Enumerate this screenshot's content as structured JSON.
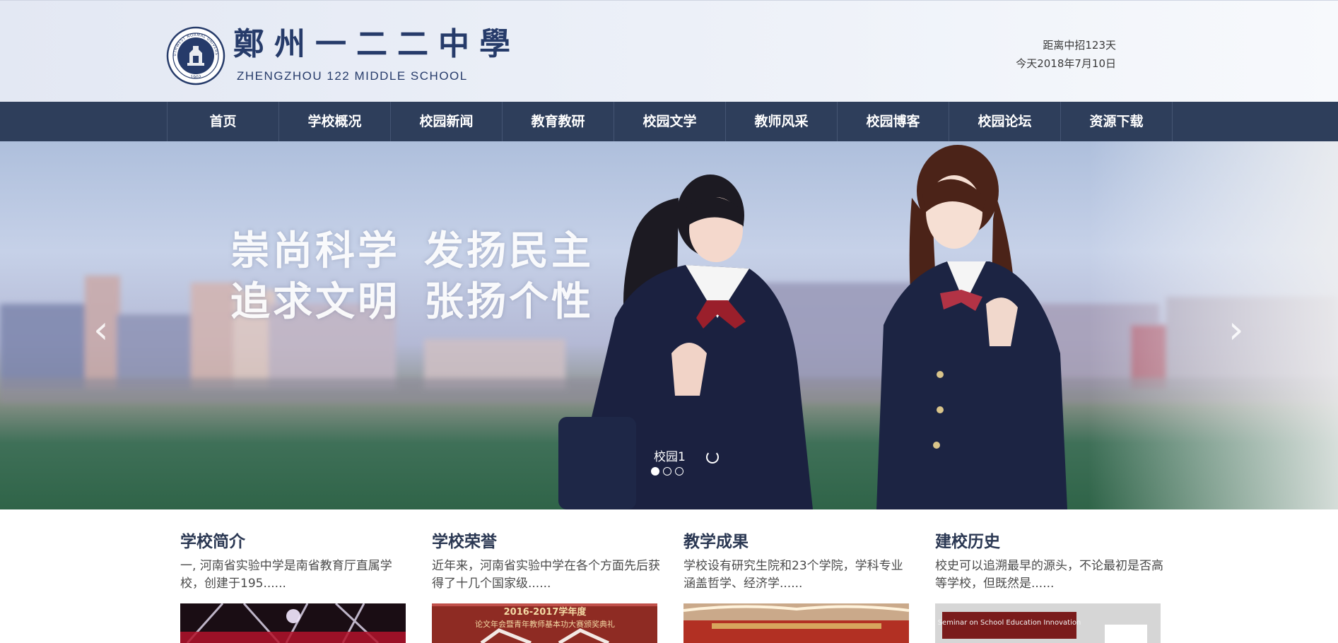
{
  "header": {
    "logo_cn": "鄭州一二二中學",
    "logo_en": "ZHENGZHOU 122 MIDDLE SCHOOL",
    "seal_text": "SOUTHWEST NORMAL UNIVERSITY",
    "seal_year": "1902",
    "countdown": "距离中招123天",
    "today": "今天2018年7月10日"
  },
  "nav": {
    "items": [
      "首页",
      "学校概况",
      "校园新闻",
      "教育教研",
      "校园文学",
      "教师风采",
      "校园博客",
      "校园论坛",
      "资源下载"
    ]
  },
  "banner": {
    "slogan_line1_a": "崇尚科学",
    "slogan_line1_b": "发扬民主",
    "slogan_line2_a": "追求文明",
    "slogan_line2_b": "张扬个性",
    "caption": "校园1",
    "prev_arrow": "‹",
    "next_arrow": "›",
    "slide_count": 3,
    "active_slide": 1
  },
  "cards": [
    {
      "title": "学校简介",
      "text": "一, 河南省实验中学是南省教育厅直属学校，创建于195......"
    },
    {
      "title": "学校荣誉",
      "text": "近年来，河南省实验中学在各个方面先后获得了十几个国家级......",
      "img_text_1": "2016-2017学年度",
      "img_text_2": "论文年会暨青年教师基本功大赛颁奖典礼"
    },
    {
      "title": "教学成果",
      "text": "学校设有研究生院和23个学院，学科专业涵盖哲学、经济学......"
    },
    {
      "title": "建校历史",
      "text": "校史可以追溯最早的源头，不论最初是否高等学校，但既然是......",
      "img_text_1": "Seminar on School Education Innovation"
    }
  ],
  "colors": {
    "nav_bg": "#2e3e5b",
    "brand": "#263b6a",
    "title": "#2b3853"
  }
}
